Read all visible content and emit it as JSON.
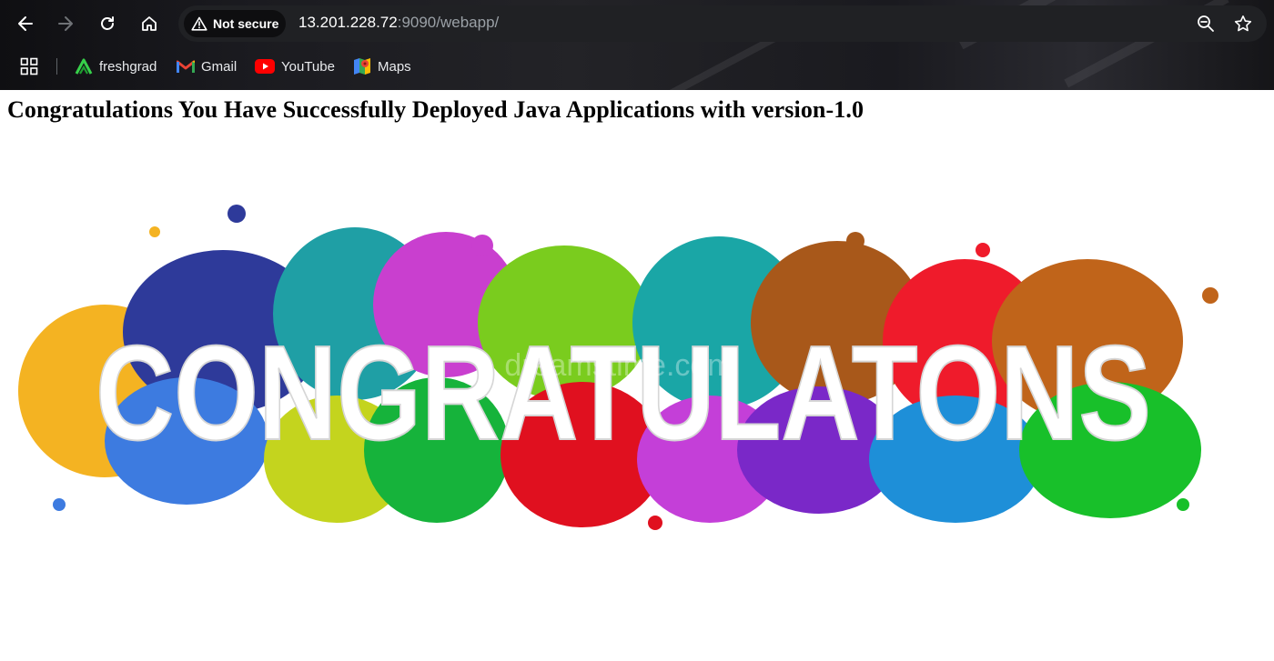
{
  "browser": {
    "security_label": "Not secure",
    "url_host": "13.201.228.72",
    "url_rest": ":9090/webapp/",
    "bookmarks": [
      {
        "label": "freshgrad",
        "icon": "freshgrad-icon"
      },
      {
        "label": "Gmail",
        "icon": "gmail-icon"
      },
      {
        "label": "YouTube",
        "icon": "youtube-icon"
      },
      {
        "label": "Maps",
        "icon": "maps-icon"
      }
    ]
  },
  "page": {
    "heading": "Congratulations You Have Successfully Deployed Java Applications with version-1.0",
    "banner_text": "CONGRATULATONS",
    "watermark": "dreamstime.com"
  },
  "colors": {
    "chrome_dark": "#1b1b20",
    "omnibox": "#202124",
    "splash": [
      "#f4b322",
      "#2e3a9a",
      "#1f9fa5",
      "#c93fcf",
      "#7acc1e",
      "#1aa6a6",
      "#a8581a",
      "#ef1b2b",
      "#c0641a"
    ]
  }
}
